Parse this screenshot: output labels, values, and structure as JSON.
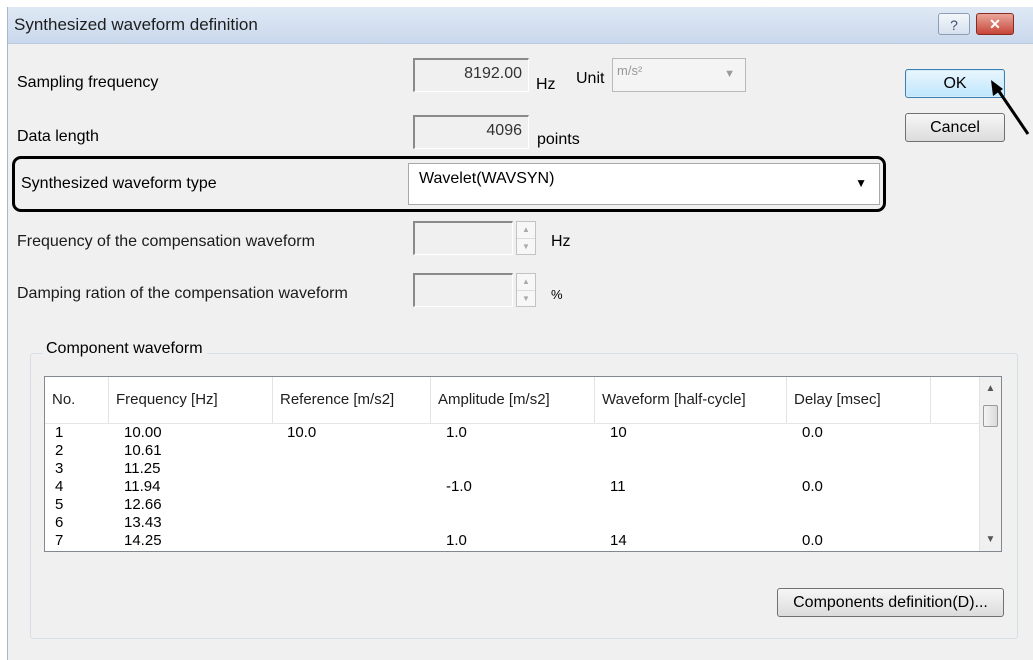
{
  "window": {
    "title": "Synthesized waveform definition",
    "help_label": "?",
    "close_label": "✕"
  },
  "fields": {
    "sampling_frequency_label": "Sampling frequency",
    "sampling_frequency_value": "8192.00",
    "sampling_frequency_unit": "Hz",
    "unit_label": "Unit",
    "unit_value": "m/s²",
    "data_length_label": "Data length",
    "data_length_value": "4096",
    "data_length_unit": "points",
    "waveform_type_label": "Synthesized waveform type",
    "waveform_type_value": "Wavelet(WAVSYN)",
    "comp_frequency_label": "Frequency of the compensation waveform",
    "comp_frequency_value": "",
    "comp_frequency_unit": "Hz",
    "damping_label": "Damping ration of the compensation waveform",
    "damping_value": "",
    "damping_unit": "%"
  },
  "buttons": {
    "ok": "OK",
    "cancel": "Cancel",
    "components_definition": "Components definition(D)..."
  },
  "component_group": {
    "title": "Component waveform",
    "columns": [
      "No.",
      "Frequency [Hz]",
      "Reference [m/s2]",
      "Amplitude [m/s2]",
      "Waveform [half-cycle]",
      "Delay [msec]"
    ],
    "rows": [
      [
        "1",
        "10.00",
        "10.0",
        "1.0",
        "10",
        "0.0"
      ],
      [
        "2",
        "10.61",
        "",
        "",
        "",
        ""
      ],
      [
        "3",
        "11.25",
        "",
        "",
        "",
        ""
      ],
      [
        "4",
        "11.94",
        "",
        "-1.0",
        "11",
        "0.0"
      ],
      [
        "5",
        "12.66",
        "",
        "",
        "",
        ""
      ],
      [
        "6",
        "13.43",
        "",
        "",
        "",
        ""
      ],
      [
        "7",
        "14.25",
        "",
        "1.0",
        "14",
        "0.0"
      ]
    ]
  },
  "icons": {
    "scroll_up": "scroll-up-arrow-icon",
    "scroll_down": "scroll-down-arrow-icon",
    "dropdown": "chevron-down-icon",
    "pointer": "arrow-pointer-icon"
  }
}
